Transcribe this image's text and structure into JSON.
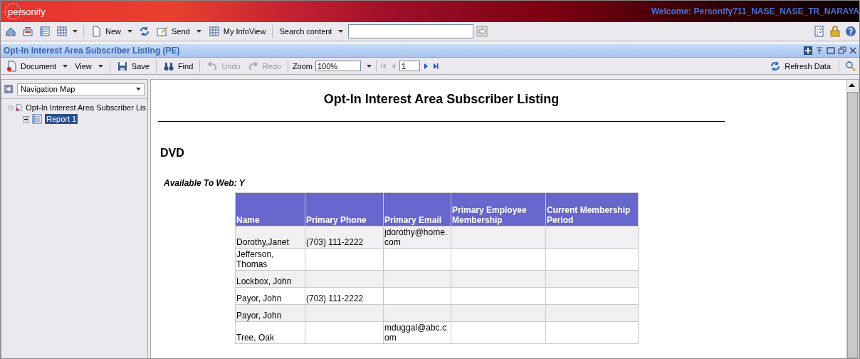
{
  "header": {
    "logo": "personify",
    "welcome": "Welcome:  Personify711_NASE_NASE_TR_NARAYA"
  },
  "toolbar": {
    "items": [
      {
        "kind": "icon"
      },
      {
        "kind": "icon"
      },
      {
        "kind": "icon"
      },
      {
        "kind": "menu-icon"
      },
      {
        "kind": "sep"
      },
      {
        "kind": "menu",
        "label": "New"
      },
      {
        "kind": "icon"
      },
      {
        "kind": "menu",
        "label": "Send"
      },
      {
        "kind": "button",
        "label": "My InfoView"
      },
      {
        "kind": "sep"
      },
      {
        "kind": "menu",
        "label": "Search content"
      }
    ]
  },
  "panel_title": "Opt-In Interest Area Subscriber Listing (PE)",
  "doc_toolbar": {
    "left": [
      {
        "kind": "menu",
        "label": "Document",
        "disabled": false
      },
      {
        "kind": "menu",
        "label": "View",
        "disabled": false
      },
      {
        "kind": "sep"
      },
      {
        "kind": "button",
        "label": "Save",
        "disabled": false
      },
      {
        "kind": "sep"
      },
      {
        "kind": "button",
        "label": "Find",
        "disabled": false
      },
      {
        "kind": "sep"
      },
      {
        "kind": "button",
        "label": "Undo",
        "disabled": true
      },
      {
        "kind": "button",
        "label": "Redo",
        "disabled": true
      },
      {
        "kind": "sep"
      },
      {
        "kind": "zoom",
        "label": "Zoom",
        "value": "100%"
      },
      {
        "kind": "sep"
      },
      {
        "kind": "pager",
        "page": "1",
        "first_disabled": true,
        "prev_disabled": true,
        "next_disabled": false,
        "last_disabled": false
      }
    ],
    "refresh": "Refresh Data"
  },
  "navigation": {
    "dropdown": "Navigation Map",
    "tree": [
      {
        "label": "Opt-In Interest Area Subscriber Lis",
        "expanded": true,
        "selected": false,
        "children": [
          {
            "label": "Report 1",
            "expanded": false,
            "selected": true
          }
        ]
      }
    ]
  },
  "report": {
    "title": "Opt-In Interest Area Subscriber Listing",
    "section": "DVD",
    "subheading": "Available To Web: Y",
    "table": {
      "columns": [
        "Name",
        "Primary Phone",
        "Primary Email",
        "Primary Employee Membership",
        "Current Membership Period"
      ],
      "rows": [
        [
          "Dorothy,Janet",
          "(703)  111-2222",
          "jdorothy@home.com",
          "",
          ""
        ],
        [
          "Jefferson, Thomas",
          "",
          "",
          "",
          ""
        ],
        [
          "Lockbox, John",
          "",
          "",
          "",
          ""
        ],
        [
          "Payor, John",
          "(703)  111-2222",
          "",
          "",
          ""
        ],
        [
          "Payor, John",
          "",
          "",
          "",
          ""
        ],
        [
          "Tree, Oak",
          "",
          "mduggal@abc.com",
          "",
          ""
        ]
      ]
    }
  }
}
